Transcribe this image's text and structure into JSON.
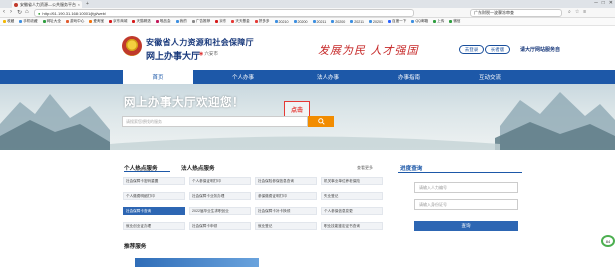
{
  "browser": {
    "tab_title": "安徽省人力资源—公共服务平台",
    "tab_close": "×",
    "new_tab": "+",
    "window_controls": [
      "─",
      "□",
      "✕"
    ],
    "url": "http://61.190.31.168:10001/jfgl/web/",
    "search_text": "广东财税一波骤冻审查",
    "bookmarks": [
      {
        "label": "收藏",
        "color": "#f2b705"
      },
      {
        "label": "手机收藏",
        "color": "#3d8fe0"
      },
      {
        "label": "网址大全",
        "color": "#2e9e3f"
      },
      {
        "label": "游戏中心",
        "color": "#e05a2e"
      },
      {
        "label": "爱淘宝",
        "color": "#f2710c"
      },
      {
        "label": "京东商城",
        "color": "#d61a1a"
      },
      {
        "label": "天猫精选",
        "color": "#d61a1a"
      },
      {
        "label": "唯品会",
        "color": "#c2185b"
      },
      {
        "label": "我的",
        "color": "#3d8fe0"
      },
      {
        "label": "广告推荐",
        "color": "#888888"
      },
      {
        "label": "京东",
        "color": "#d61a1a"
      },
      {
        "label": "天天基金",
        "color": "#e53935"
      },
      {
        "label": "拼多多",
        "color": "#e53935"
      },
      {
        "label": "20210",
        "color": "#3d8fe0"
      },
      {
        "label": "20200",
        "color": "#3d8fe0"
      },
      {
        "label": "20211",
        "color": "#3d8fe0"
      },
      {
        "label": "20200",
        "color": "#3d8fe0"
      },
      {
        "label": "20211",
        "color": "#3d8fe0"
      },
      {
        "label": "20201",
        "color": "#3d8fe0"
      },
      {
        "label": "百度一下",
        "color": "#2962ff"
      },
      {
        "label": "QQ邮箱",
        "color": "#3d8fe0"
      },
      {
        "label": "上传",
        "color": "#2e9e3f"
      },
      {
        "label": "微信",
        "color": "#2e9e3f"
      }
    ]
  },
  "header": {
    "title_line1": "安徽省人力资源和社会保障厅",
    "title_line2": "网上办事大厅",
    "location": "六安市",
    "slogan": "发展为民 人才强国",
    "login_label": "去登录",
    "elder_label": "长者版",
    "survey_label": "请大厅网站服务自"
  },
  "nav": {
    "items": [
      "首页",
      "个人办事",
      "法人办事",
      "办事指南",
      "互动交流"
    ],
    "active_index": 0
  },
  "hero": {
    "title": "网上办事大厅欢迎您！",
    "search_placeholder": "请搜索您想找的服务",
    "annotation": "点击"
  },
  "hot_services": {
    "tab_personal": "个人热点服务",
    "tab_corporate": "法人热点服务",
    "more_label": "查看更多",
    "items": [
      {
        "label": "社会保障卡密码重置",
        "highlight": false
      },
      {
        "label": "个人参保证明打印",
        "highlight": false
      },
      {
        "label": "社会保险参保信息查询",
        "highlight": false
      },
      {
        "label": "机关事业单位养老保险",
        "highlight": false
      },
      {
        "label": "个人缴费明细打印",
        "highlight": false
      },
      {
        "label": "社会保障卡业务办理",
        "highlight": false
      },
      {
        "label": "参保缴费证明打印",
        "highlight": false
      },
      {
        "label": "失业登记",
        "highlight": false
      },
      {
        "label": "社会保障卡查询",
        "highlight": true
      },
      {
        "label": "2022届毕业生求职创业",
        "highlight": false
      },
      {
        "label": "社会保障卡补卡换领",
        "highlight": false
      },
      {
        "label": "个人参保信息变更",
        "highlight": false
      },
      {
        "label": "就业创业证办理",
        "highlight": false
      },
      {
        "label": "社会保障卡申领",
        "highlight": false
      },
      {
        "label": "就业登记",
        "highlight": false
      },
      {
        "label": "职业技能鉴定证书查询",
        "highlight": false
      }
    ]
  },
  "recommend": {
    "title": "推荐服务"
  },
  "progress": {
    "title": "进度查询",
    "name_placeholder": "请输入人力编号",
    "id_placeholder": "请输入身份证号",
    "query_label": "查询"
  },
  "widget": {
    "badge": "84"
  }
}
